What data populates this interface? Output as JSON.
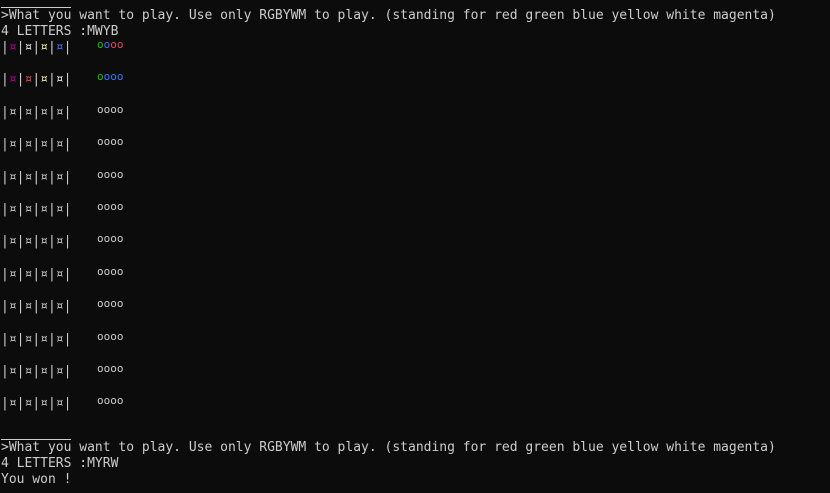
{
  "colors": {
    "background": "#0c0c0c",
    "text": "#cccccc",
    "red": "#e74856",
    "green": "#16c60c",
    "blue": "#3b78ff",
    "yellow": "#f9f1a5",
    "white": "#f2f2f2",
    "magenta": "#b4009e"
  },
  "prompt_1": ">What you want to play. Use only RGBYWM to play. (standing for red green blue yellow white magenta)",
  "input_1": "4 LETTERS :MWYB",
  "board": {
    "sep": "|",
    "slot_glyph": "¤",
    "peg_glyph": "o",
    "rows": [
      {
        "slots": [
          "magenta",
          "white",
          "yellow",
          "blue"
        ],
        "pegs": [
          "green",
          "blue",
          "red",
          "red"
        ]
      },
      {
        "slots": [
          "magenta",
          "red",
          "yellow",
          "white"
        ],
        "pegs": [
          "green",
          "blue",
          "blue",
          "blue"
        ]
      },
      {
        "slots": [
          "default",
          "default",
          "default",
          "default"
        ],
        "pegs": [
          "default",
          "default",
          "default",
          "default"
        ]
      },
      {
        "slots": [
          "default",
          "default",
          "default",
          "default"
        ],
        "pegs": [
          "default",
          "default",
          "default",
          "default"
        ]
      },
      {
        "slots": [
          "default",
          "default",
          "default",
          "default"
        ],
        "pegs": [
          "default",
          "default",
          "default",
          "default"
        ]
      },
      {
        "slots": [
          "default",
          "default",
          "default",
          "default"
        ],
        "pegs": [
          "default",
          "default",
          "default",
          "default"
        ]
      },
      {
        "slots": [
          "default",
          "default",
          "default",
          "default"
        ],
        "pegs": [
          "default",
          "default",
          "default",
          "default"
        ]
      },
      {
        "slots": [
          "default",
          "default",
          "default",
          "default"
        ],
        "pegs": [
          "default",
          "default",
          "default",
          "default"
        ]
      },
      {
        "slots": [
          "default",
          "default",
          "default",
          "default"
        ],
        "pegs": [
          "default",
          "default",
          "default",
          "default"
        ]
      },
      {
        "slots": [
          "default",
          "default",
          "default",
          "default"
        ],
        "pegs": [
          "default",
          "default",
          "default",
          "default"
        ]
      },
      {
        "slots": [
          "default",
          "default",
          "default",
          "default"
        ],
        "pegs": [
          "default",
          "default",
          "default",
          "default"
        ]
      },
      {
        "slots": [
          "default",
          "default",
          "default",
          "default"
        ],
        "pegs": [
          "default",
          "default",
          "default",
          "default"
        ]
      }
    ]
  },
  "prompt_2": ">What you want to play. Use only RGBYWM to play. (standing for red green blue yellow white magenta)",
  "input_2": "4 LETTERS :MYRW",
  "result": "You won !"
}
